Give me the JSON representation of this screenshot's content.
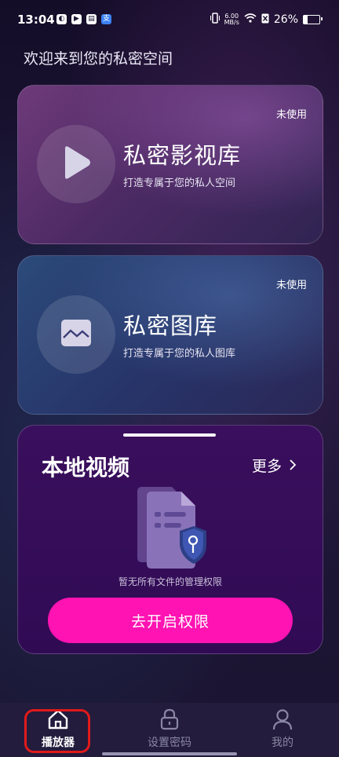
{
  "status_bar": {
    "time": "13:04",
    "app_icons": [
      "circle-app-icon",
      "play-store-icon",
      "tray-icon",
      "alipay-icon"
    ],
    "alipay_char": "支",
    "net_speed_value": "6.00",
    "net_speed_unit": "MB/s",
    "battery": "26%"
  },
  "welcome": "欢迎来到您的私密空间",
  "cards": [
    {
      "title": "私密影视库",
      "subtitle": "打造专属于您的私人空间",
      "badge": "未使用",
      "icon": "play-icon"
    },
    {
      "title": "私密图库",
      "subtitle": "打造专属于您的私人图库",
      "badge": "未使用",
      "icon": "image-icon"
    }
  ],
  "local_videos": {
    "title": "本地视频",
    "more": "更多",
    "empty_message": "暂无所有文件的管理权限",
    "enable_button": "去开启权限"
  },
  "tab_bar": {
    "items": [
      {
        "label": "播放器",
        "icon": "home-icon",
        "active": true
      },
      {
        "label": "设置密码",
        "icon": "lock-icon",
        "active": false
      },
      {
        "label": "我的",
        "icon": "person-icon",
        "active": false
      }
    ]
  },
  "colors": {
    "accent": "#ff13b2",
    "panel": "#3a0f5d",
    "highlight_outline": "#e11a1a"
  }
}
